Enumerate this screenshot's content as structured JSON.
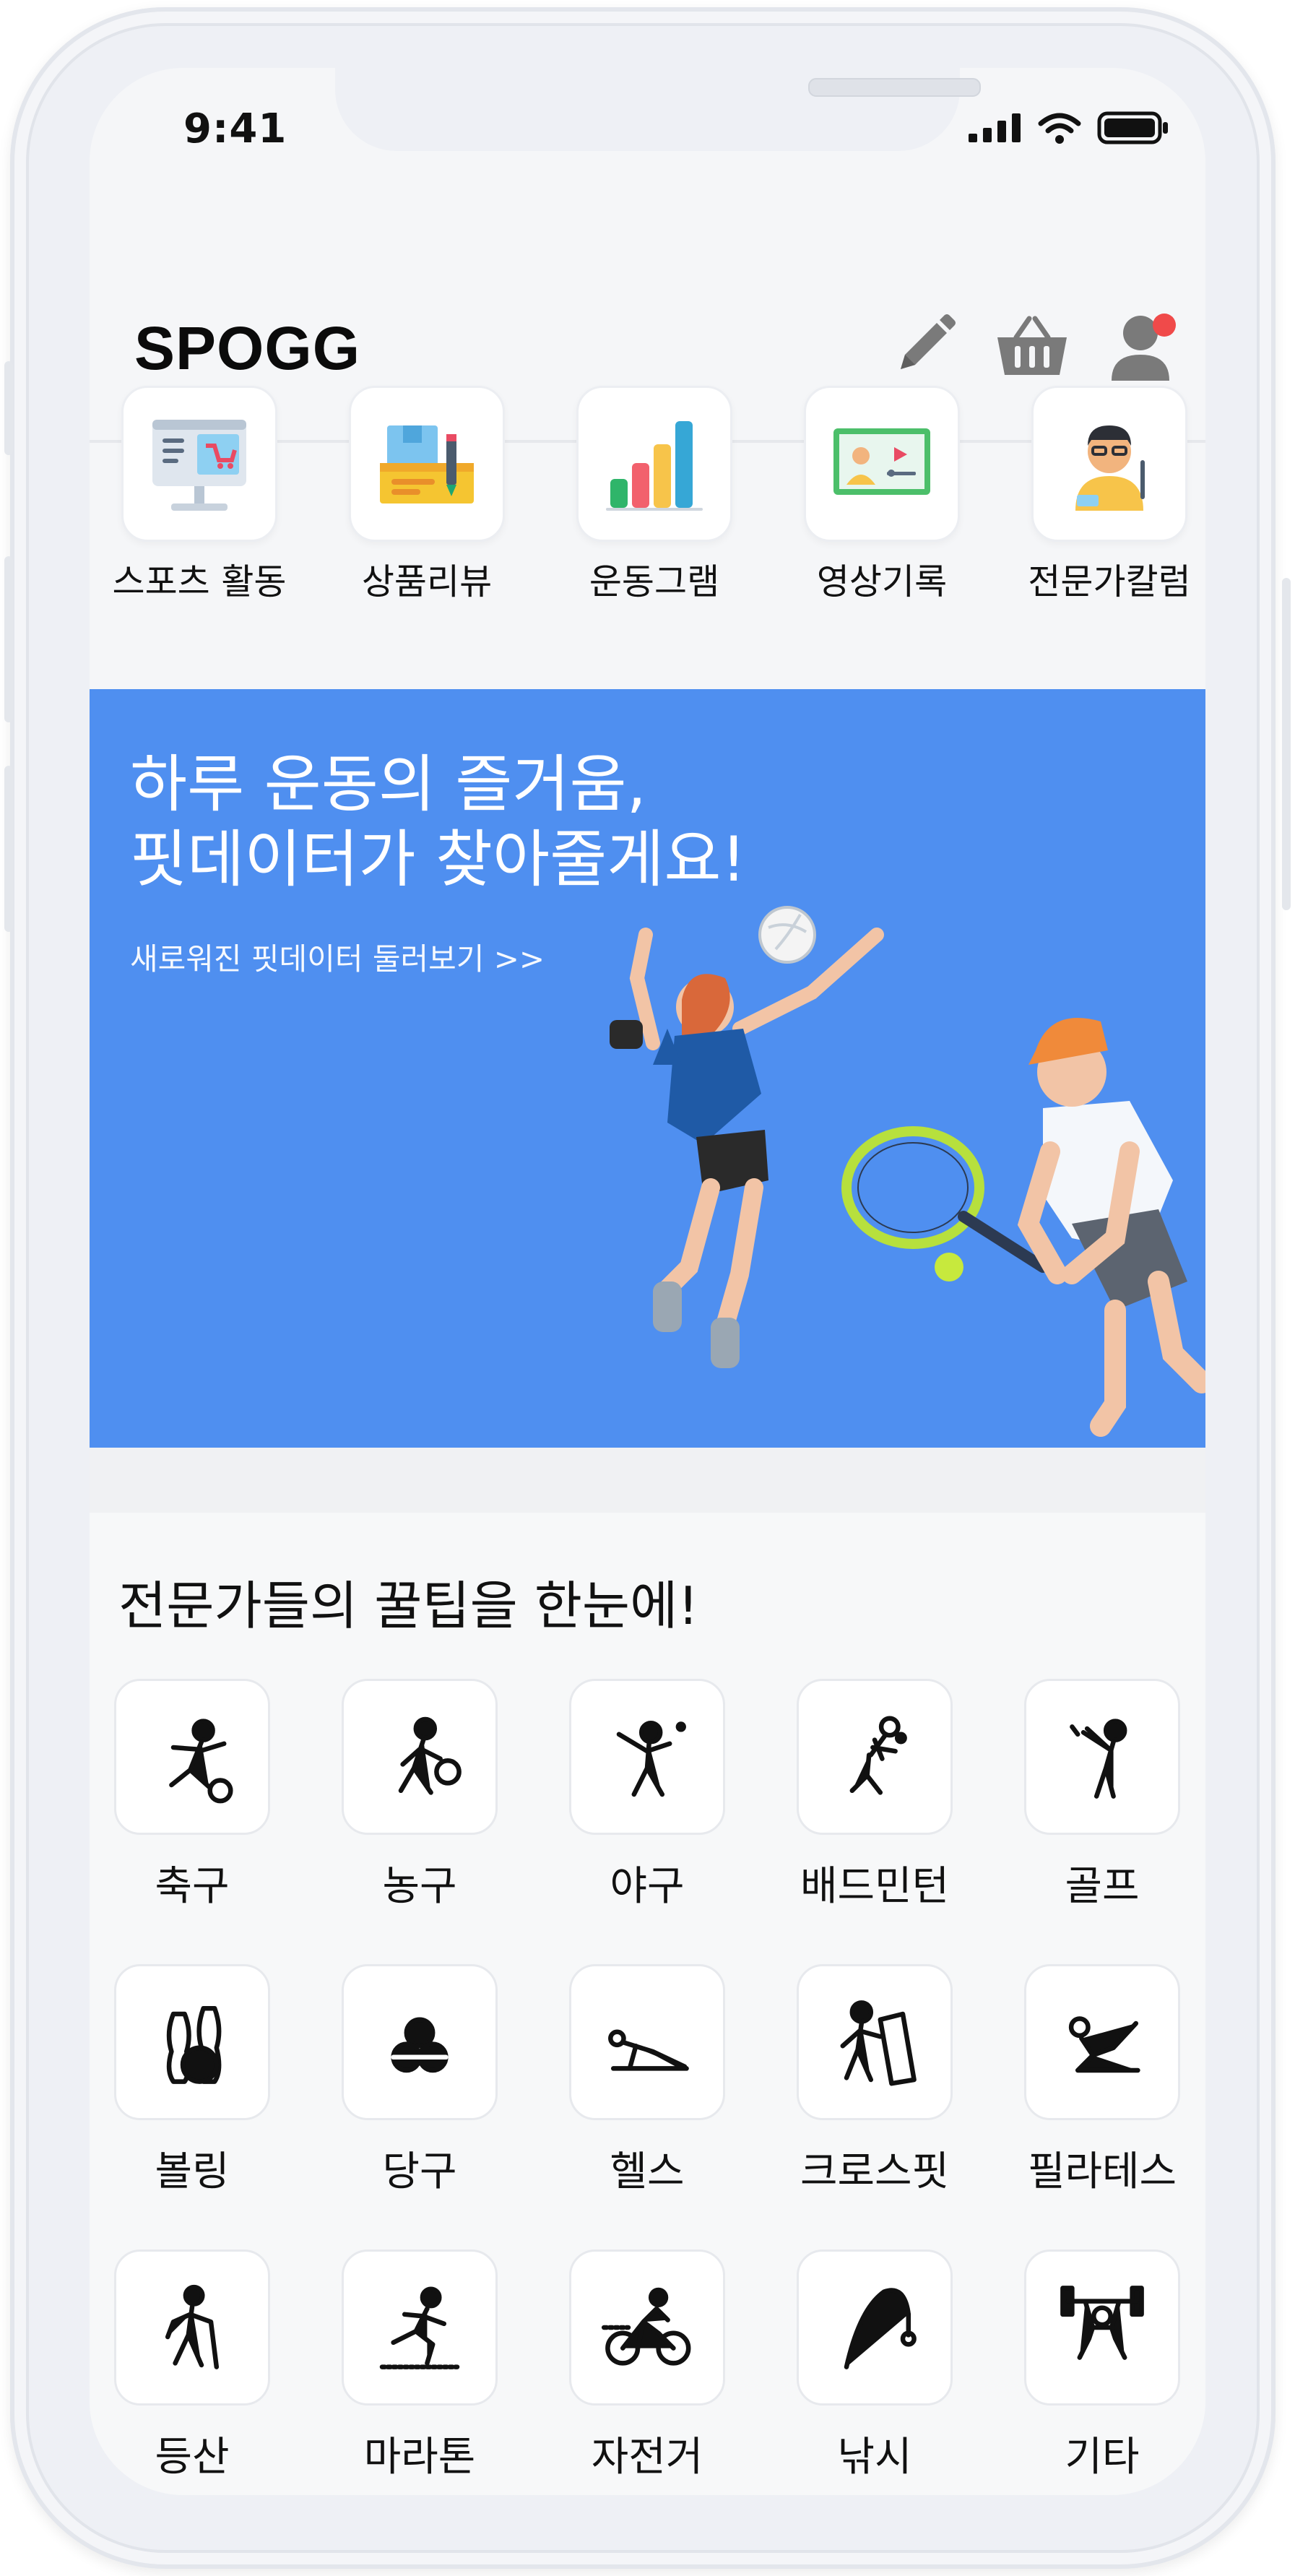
{
  "status_bar": {
    "time": "9:41"
  },
  "header": {
    "brand": "SPOGG"
  },
  "quick_menu": [
    {
      "label": "스포츠 활동",
      "icon": "store-kiosk-icon"
    },
    {
      "label": "상품리뷰",
      "icon": "shopping-box-icon"
    },
    {
      "label": "운동그램",
      "icon": "bar-chart-icon"
    },
    {
      "label": "영상기록",
      "icon": "video-board-icon"
    },
    {
      "label": "전문가칼럼",
      "icon": "expert-avatar-icon"
    }
  ],
  "banner": {
    "title": "하루 운동의 즐거움,\n핏데이터가 찾아줄게요!",
    "link": "새로워진 핏데이터 둘러보기 >>"
  },
  "tips": {
    "title": "전문가들의 꿀팁을 한눈에!",
    "sports": [
      {
        "label": "축구",
        "icon": "soccer-icon"
      },
      {
        "label": "농구",
        "icon": "basketball-icon"
      },
      {
        "label": "야구",
        "icon": "baseball-icon"
      },
      {
        "label": "배드민턴",
        "icon": "badminton-icon"
      },
      {
        "label": "골프",
        "icon": "golf-icon"
      },
      {
        "label": "볼링",
        "icon": "bowling-icon"
      },
      {
        "label": "당구",
        "icon": "billiards-icon"
      },
      {
        "label": "헬스",
        "icon": "fitness-icon"
      },
      {
        "label": "크로스핏",
        "icon": "crossfit-icon"
      },
      {
        "label": "필라테스",
        "icon": "pilates-icon"
      },
      {
        "label": "등산",
        "icon": "hiking-icon"
      },
      {
        "label": "마라톤",
        "icon": "marathon-icon"
      },
      {
        "label": "자전거",
        "icon": "cycling-icon"
      },
      {
        "label": "낚시",
        "icon": "fishing-icon"
      },
      {
        "label": "기타",
        "icon": "weightlifting-icon"
      }
    ]
  },
  "colors": {
    "banner": "#4f8ff0",
    "notification": "#f04a4a",
    "icon_gray": "#7a7a7a"
  }
}
